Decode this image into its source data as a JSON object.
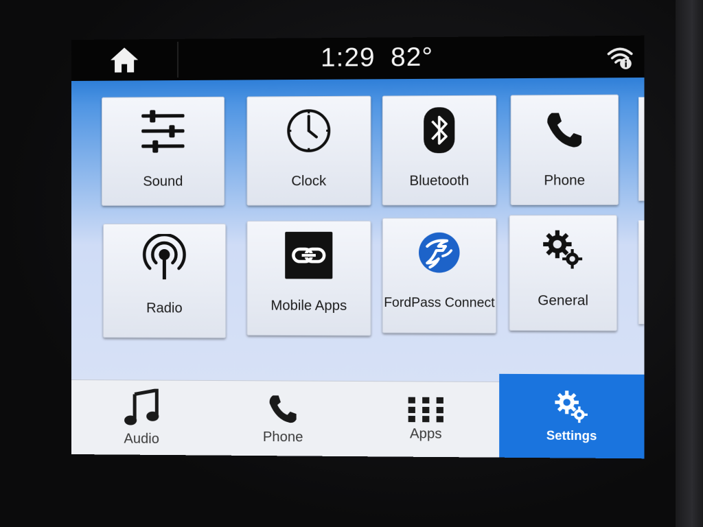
{
  "status_bar": {
    "time": "1:29",
    "temperature": "82°",
    "home_icon": "home-icon",
    "wifi_icon": "wifi-info-icon"
  },
  "apps_grid": {
    "tiles": [
      {
        "label": "Sound",
        "icon": "sliders-icon"
      },
      {
        "label": "Clock",
        "icon": "clock-icon"
      },
      {
        "label": "Bluetooth",
        "icon": "bluetooth-icon"
      },
      {
        "label": "Phone",
        "icon": "phone-icon"
      },
      {
        "label": "Radio",
        "icon": "radio-icon"
      },
      {
        "label": "Mobile Apps",
        "icon": "link-icon"
      },
      {
        "label": "FordPass Connect",
        "icon": "fordpass-icon"
      },
      {
        "label": "General",
        "icon": "gears-icon"
      }
    ],
    "pages": 2,
    "current_page": 1
  },
  "bottom_nav": {
    "items": [
      {
        "label": "Audio",
        "icon": "music-note-icon"
      },
      {
        "label": "Phone",
        "icon": "phone-icon"
      },
      {
        "label": "Apps",
        "icon": "grid-icon"
      },
      {
        "label": "Settings",
        "icon": "gears-icon"
      }
    ],
    "active": "Settings"
  },
  "colors": {
    "accent_blue": "#1a74de",
    "fordpass_blue": "#1d63c9",
    "active_dot": "#1a74de",
    "inactive_dot": "#4a5266"
  }
}
